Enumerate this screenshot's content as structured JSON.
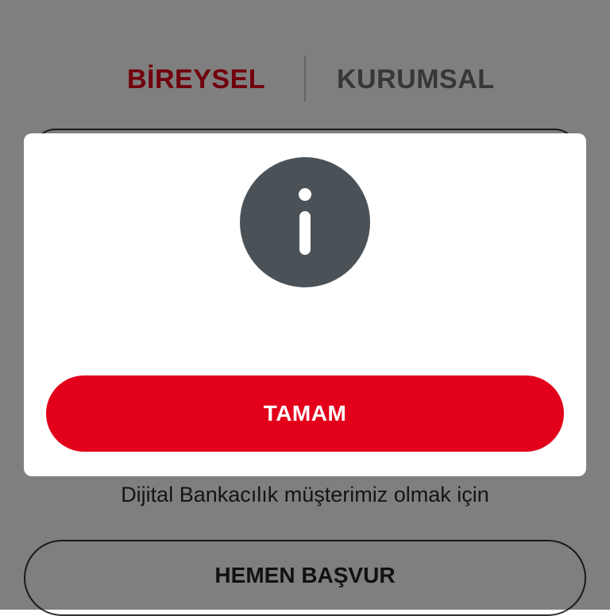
{
  "tabs": {
    "bireysel_label": "BİREYSEL",
    "kurumsal_label": "KURUMSAL"
  },
  "login": {
    "info_text": "Dijital Bankacılık müşterimiz olmak için",
    "apply_label": "HEMEN BAŞVUR"
  },
  "dialog": {
    "icon": "info-icon",
    "ok_label": "TAMAM"
  },
  "colors": {
    "brand_red": "#e3001b",
    "overlay": "rgba(0,0,0,0.5)",
    "info_badge": "#4b5257",
    "inactive_tab": "#6a6f73"
  }
}
